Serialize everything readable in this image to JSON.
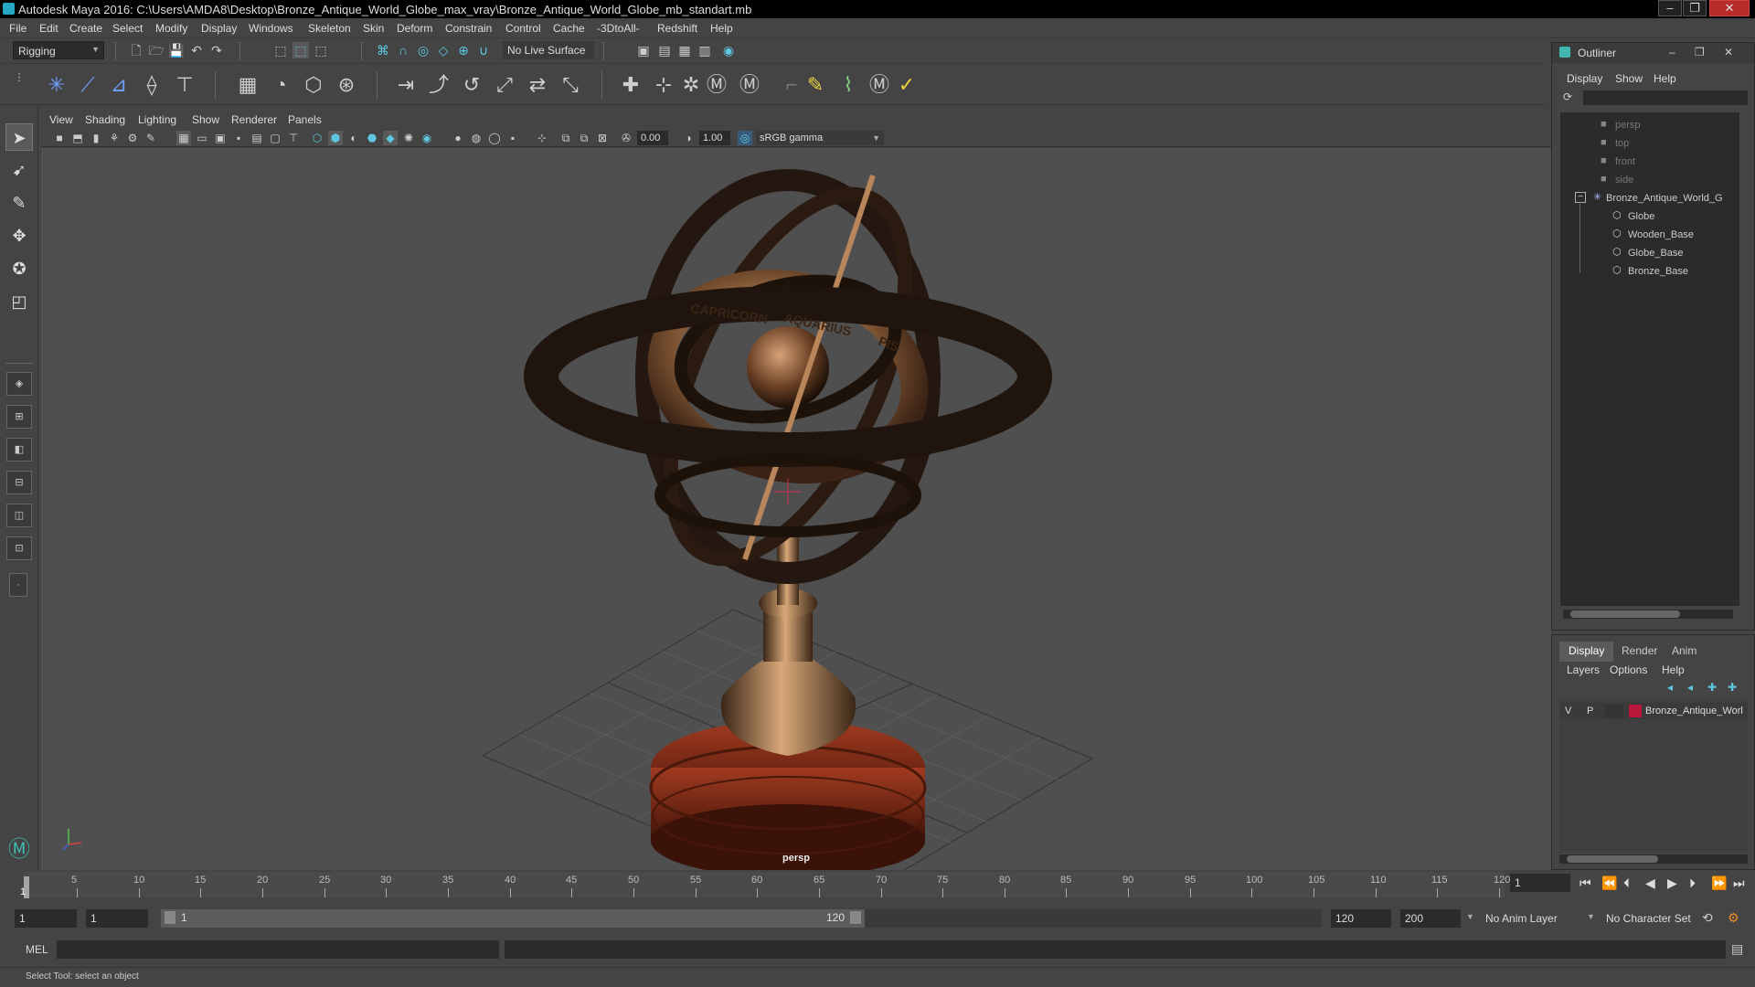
{
  "window": {
    "title": "Autodesk Maya 2016: C:\\Users\\AMDA8\\Desktop\\Bronze_Antique_World_Globe_max_vray\\Bronze_Antique_World_Globe_mb_standart.mb",
    "minimize": "–",
    "maximize": "❐",
    "close": "✕"
  },
  "menubar": [
    "File",
    "Edit",
    "Create",
    "Select",
    "Modify",
    "Display",
    "Windows",
    "Skeleton",
    "Skin",
    "Deform",
    "Constrain",
    "Control",
    "Cache",
    "-3DtoAll-",
    "Redshift",
    "Help"
  ],
  "statusline": {
    "mode": "Rigging",
    "live_surface": "No Live Surface"
  },
  "viewport": {
    "menus": [
      "View",
      "Shading",
      "Lighting",
      "Show",
      "Renderer",
      "Panels"
    ],
    "exposure": "0.00",
    "gamma": "1.00",
    "color_space": "sRGB gamma",
    "camera": "persp",
    "ring_labels": [
      "CAPRICORN",
      "AQUARIUS",
      "PIS"
    ]
  },
  "outliner": {
    "title": "Outliner",
    "menus": [
      "Display",
      "Show",
      "Help"
    ],
    "items": [
      {
        "label": "persp",
        "dim": true
      },
      {
        "label": "top",
        "dim": true
      },
      {
        "label": "front",
        "dim": true
      },
      {
        "label": "side",
        "dim": true
      },
      {
        "label": "Bronze_Antique_World_G",
        "dim": false
      },
      {
        "label": "Globe",
        "dim": false
      },
      {
        "label": "Wooden_Base",
        "dim": false
      },
      {
        "label": "Globe_Base",
        "dim": false
      },
      {
        "label": "Bronze_Base",
        "dim": false
      }
    ]
  },
  "layers": {
    "tabs": [
      "Display",
      "Render",
      "Anim"
    ],
    "menus": [
      "Layers",
      "Options",
      "Help"
    ],
    "row": {
      "v": "V",
      "p": "P",
      "name": "Bronze_Antique_Worl",
      "color": "#b8163a"
    }
  },
  "timeline": {
    "ticks": [
      5,
      10,
      15,
      20,
      25,
      30,
      35,
      40,
      45,
      50,
      55,
      60,
      65,
      70,
      75,
      80,
      85,
      90,
      95,
      100,
      105,
      110,
      115,
      120
    ],
    "current_marker": "1",
    "current_frame": "1"
  },
  "range": {
    "start": "1",
    "start2": "1",
    "slider_start": "1",
    "slider_end": "120",
    "end": "120",
    "total_end": "200",
    "anim_layer": "No Anim Layer",
    "char_set": "No Character Set"
  },
  "cmdline": {
    "lang": "MEL"
  },
  "helpline": {
    "text": "Select Tool: select an object"
  }
}
